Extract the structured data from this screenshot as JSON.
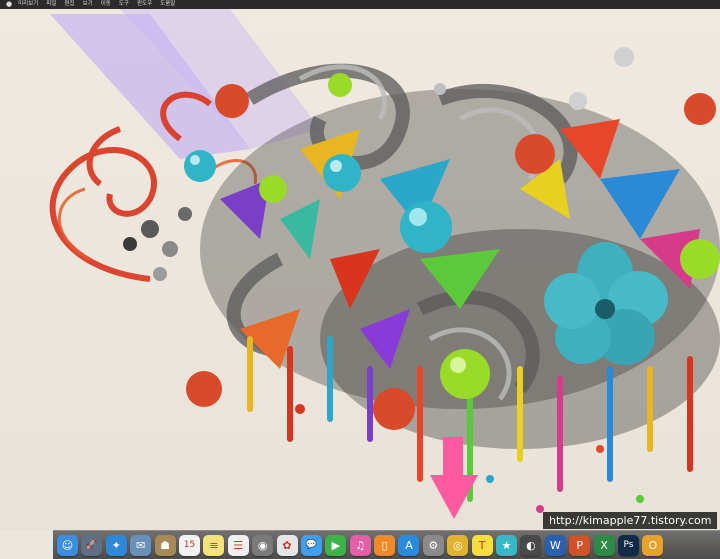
{
  "menubar": {
    "items": [
      "미리보기",
      "파일",
      "편집",
      "보기",
      "이동",
      "도구",
      "윈도우",
      "도움말"
    ]
  },
  "watermark": {
    "text": "http://kimapple77.tistory.com"
  },
  "dock": {
    "icons": [
      {
        "name": "finder-icon",
        "glyph": "☺",
        "color": "#3b8fe0"
      },
      {
        "name": "launchpad-icon",
        "glyph": "🚀",
        "color": "#5e6e85"
      },
      {
        "name": "safari-icon",
        "glyph": "✦",
        "color": "#2f87d8"
      },
      {
        "name": "mail-icon",
        "glyph": "✉",
        "color": "#6a8fb8"
      },
      {
        "name": "contacts-icon",
        "glyph": "☗",
        "color": "#a88a58"
      },
      {
        "name": "calendar-icon",
        "glyph": "15",
        "color": "#f2f2f2"
      },
      {
        "name": "notes-icon",
        "glyph": "≡",
        "color": "#f4e27a"
      },
      {
        "name": "reminders-icon",
        "glyph": "☰",
        "color": "#f0f0f0"
      },
      {
        "name": "photo-booth-icon",
        "glyph": "◉",
        "color": "#7a7a7a"
      },
      {
        "name": "photos-icon",
        "glyph": "✿",
        "color": "#e6e6e6"
      },
      {
        "name": "messages-icon",
        "glyph": "💬",
        "color": "#3fa0f0"
      },
      {
        "name": "facetime-icon",
        "glyph": "▶",
        "color": "#3cb44a"
      },
      {
        "name": "itunes-icon",
        "glyph": "♫",
        "color": "#e45fa8"
      },
      {
        "name": "ibooks-icon",
        "glyph": "▯",
        "color": "#ef8a2a"
      },
      {
        "name": "app-store-icon",
        "glyph": "A",
        "color": "#2a8ae0"
      },
      {
        "name": "system-preferences-icon",
        "glyph": "⚙",
        "color": "#8a8a8a"
      },
      {
        "name": "chrome-icon",
        "glyph": "◎",
        "color": "#e0b32a"
      },
      {
        "name": "kakaotalk-icon",
        "glyph": "T",
        "color": "#f7de3a"
      },
      {
        "name": "star-app-icon",
        "glyph": "★",
        "color": "#36b8c8"
      },
      {
        "name": "game-icon",
        "glyph": "◐",
        "color": "#4a4a4a"
      },
      {
        "name": "word-icon",
        "glyph": "W",
        "color": "#2b5fb0"
      },
      {
        "name": "powerpoint-icon",
        "glyph": "P",
        "color": "#d2502a"
      },
      {
        "name": "excel-icon",
        "glyph": "X",
        "color": "#2e8a46"
      },
      {
        "name": "photoshop-icon",
        "glyph": "Ps",
        "color": "#112a48"
      },
      {
        "name": "outlook-icon",
        "glyph": "O",
        "color": "#e7a22a"
      }
    ]
  },
  "colors": {
    "menubar": "#2b2b2b",
    "dock": "#5a5a5a",
    "arrow": "#ff5aa0"
  }
}
